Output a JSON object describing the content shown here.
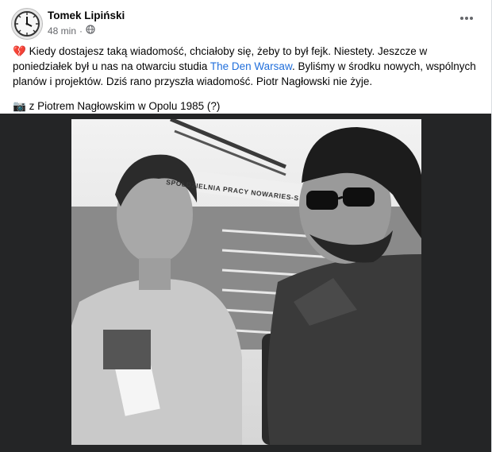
{
  "post": {
    "author": "Tomek Lipiński",
    "time": "48 min",
    "separator": "·",
    "more_icon": "more-horizontal-icon",
    "audience_icon": "globe-icon",
    "heart_emoji": "💔",
    "text_before_link": "Kiedy dostajesz taką wiadomość, chciałoby się, żeby to był fejk. Niestety. Jeszcze w poniedziałek był u nas na otwarciu studia ",
    "link_text": "The Den Warsaw",
    "text_after_link": ". Byliśmy w środku nowych, wspólnych planów i projektów. Dziś rano przyszła wiadomość. Piotr Nagłowski nie żyje.",
    "camera_emoji": "📷",
    "caption": " z Piotrem Nagłowskim w Opolu 1985 (?)",
    "photo": {
      "description_icon": "photo",
      "banner_text": "SPÓŁDZIELNIA PRACY NOWARIES-S"
    }
  },
  "colors": {
    "link": "#216fdb",
    "secondary_text": "#65676b",
    "photo_backdrop": "#242526"
  }
}
